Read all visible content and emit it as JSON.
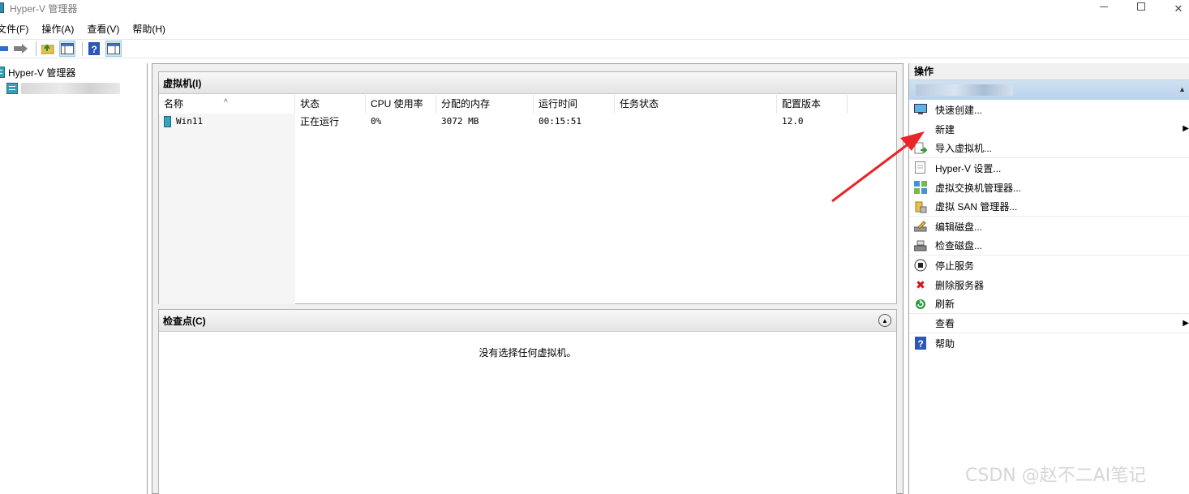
{
  "window": {
    "title": "Hyper-V 管理器"
  },
  "menubar": {
    "items": [
      "文件(F)",
      "操作(A)",
      "查看(V)",
      "帮助(H)"
    ]
  },
  "tree": {
    "root_label": "Hyper-V 管理器"
  },
  "vm_pane": {
    "title": "虚拟机(I)",
    "columns": [
      "名称",
      "状态",
      "CPU 使用率",
      "分配的内存",
      "运行时间",
      "任务状态",
      "配置版本"
    ],
    "rows": [
      {
        "name": "Win11",
        "state": "正在运行",
        "cpu": "0%",
        "memory": "3072 MB",
        "uptime": "00:15:51",
        "task": "",
        "version": "12.0"
      }
    ]
  },
  "checkpoint_pane": {
    "title": "检查点(C)",
    "empty_text": "没有选择任何虚拟机。"
  },
  "actions": {
    "title": "操作",
    "items": [
      {
        "label": "快速创建...",
        "icon": "quick-create-icon"
      },
      {
        "label": "新建",
        "icon": "none",
        "submenu": true
      },
      {
        "label": "导入虚拟机...",
        "icon": "import-icon"
      },
      {
        "label": "Hyper-V 设置...",
        "icon": "settings-page-icon"
      },
      {
        "label": "虚拟交换机管理器...",
        "icon": "switch-icon"
      },
      {
        "label": "虚拟 SAN 管理器...",
        "icon": "san-icon"
      },
      {
        "label": "编辑磁盘...",
        "icon": "edit-disk-icon"
      },
      {
        "label": "检查磁盘...",
        "icon": "inspect-disk-icon"
      },
      {
        "label": "停止服务",
        "icon": "stop-icon"
      },
      {
        "label": "删除服务器",
        "icon": "delete-icon"
      },
      {
        "label": "刷新",
        "icon": "refresh-icon"
      },
      {
        "label": "查看",
        "icon": "none",
        "submenu": true
      },
      {
        "label": "帮助",
        "icon": "help-icon"
      }
    ]
  },
  "watermark": "CSDN @赵不二AI笔记",
  "colors": {
    "annotation_arrow": "#e8262a",
    "section_header": "#c3d8ef"
  }
}
